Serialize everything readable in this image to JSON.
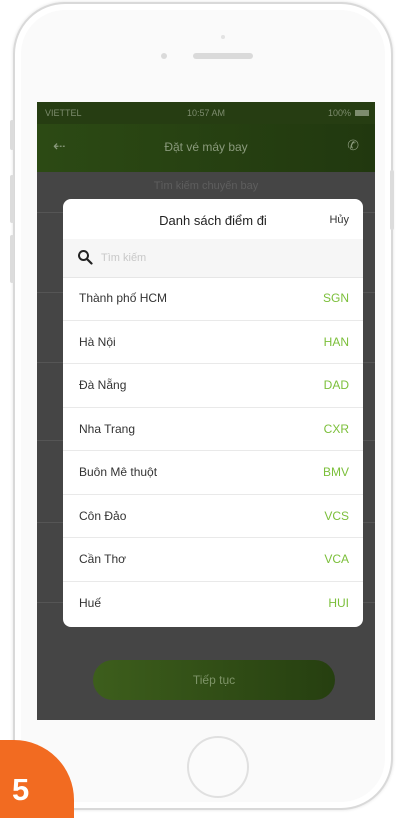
{
  "statusbar": {
    "carrier": "VIETTEL ",
    "time": "10:57 AM",
    "battery": "100%"
  },
  "appbar": {
    "title": "Đặt vé máy bay",
    "back_icon": "back-arrow-icon",
    "phone_icon": "phone-icon"
  },
  "background": {
    "subtitle": "Tìm kiếm chuyến bay",
    "continue_label": "Tiếp tục"
  },
  "modal": {
    "title": "Danh sách điểm đi",
    "cancel_label": "Hủy",
    "search": {
      "placeholder": "Tìm kiếm",
      "value": ""
    },
    "items": [
      {
        "name": "Thành phố HCM",
        "code": "SGN"
      },
      {
        "name": "Hà Nội",
        "code": "HAN"
      },
      {
        "name": "Đà Nẵng",
        "code": "DAD"
      },
      {
        "name": "Nha Trang",
        "code": "CXR"
      },
      {
        "name": "Buôn Mê thuột",
        "code": "BMV"
      },
      {
        "name": "Côn Đảo",
        "code": "VCS"
      },
      {
        "name": "Cần Thơ",
        "code": "VCA"
      },
      {
        "name": "Huế",
        "code": "HUI"
      }
    ]
  },
  "step_badge": {
    "number": "5"
  },
  "colors": {
    "accent_green": "#7bbf3a",
    "header_green": "#2c4a14",
    "badge_orange": "#f26b21"
  }
}
